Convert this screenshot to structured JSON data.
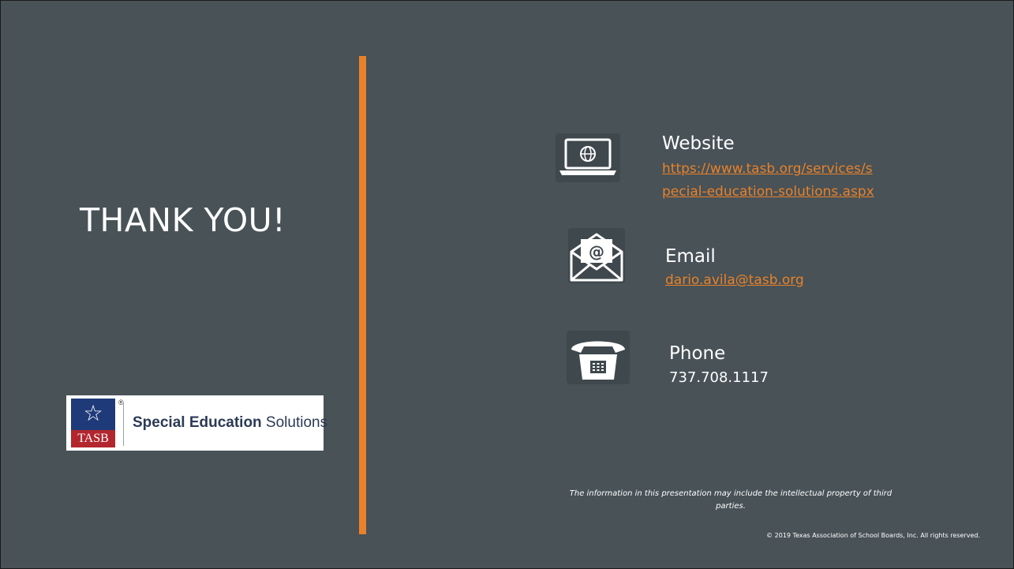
{
  "slide": {
    "heading": "THANK YOU!",
    "accent_color": "#e8812a",
    "background_color": "#485257"
  },
  "logo": {
    "badge_text": "TASB",
    "registered_mark": "®",
    "name_bold": "Special Education",
    "name_light": " Solutions"
  },
  "contacts": {
    "website": {
      "icon": "laptop-globe-icon",
      "label": "Website",
      "link": "https://www.tasb.org/services/special-education-solutions.aspx",
      "link_line1": "https://www.tasb.org/services/s",
      "link_line2": "pecial-education-solutions.aspx"
    },
    "email": {
      "icon": "envelope-at-icon",
      "label": "Email",
      "link": "dario.avila@tasb.org"
    },
    "phone": {
      "icon": "telephone-icon",
      "label": "Phone",
      "value": "737.708.1117"
    }
  },
  "footer": {
    "disclaimer": "The information in this presentation may include the intellectual property of third parties.",
    "copyright": "© 2019 Texas Association of School Boards, Inc. All rights reserved."
  }
}
